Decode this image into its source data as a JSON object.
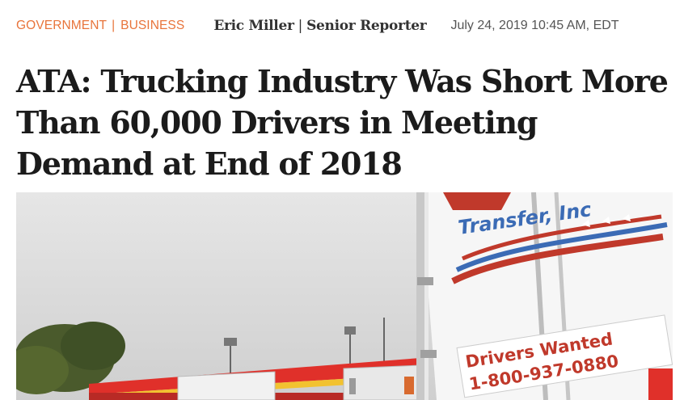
{
  "article": {
    "categories": [
      "GOVERNMENT",
      "BUSINESS"
    ],
    "category_separator": "|",
    "author": "Eric Miller",
    "byline_separator": "|",
    "author_title": "Senior Reporter",
    "date": "July 24, 2019 10:45 AM, EDT",
    "headline": "ATA: Trucking Industry Was Short More Than 60,000 Drivers in Meeting Demand at End of 2018"
  },
  "hero_image": {
    "trailer_logo_text": "Transfer, Inc",
    "sign_line1": "Drivers Wanted",
    "sign_line2": "1-800-937-0880"
  },
  "colors": {
    "category": "#e8743b",
    "headline": "#1b1b1b",
    "sky": "#dcdcdc",
    "sign_red": "#c0392b",
    "trailer_blue": "#3b6bb5"
  }
}
